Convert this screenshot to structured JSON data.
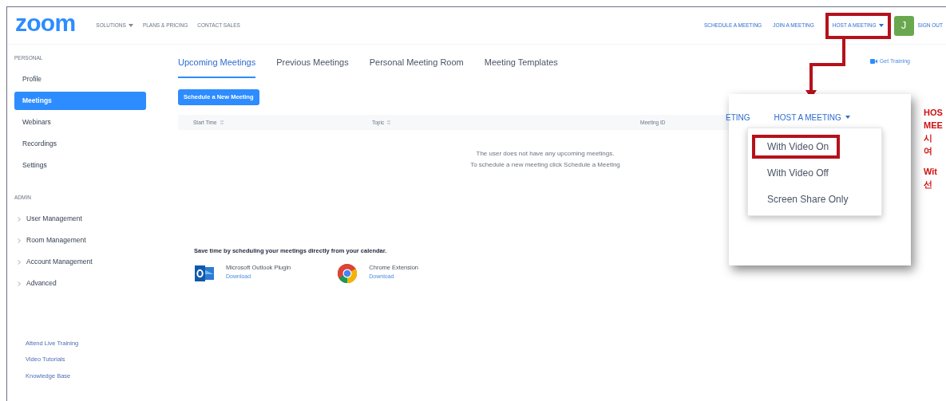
{
  "header": {
    "logo": "zoom",
    "nav": [
      {
        "label": "SOLUTIONS",
        "dropdown": true
      },
      {
        "label": "PLANS & PRICING",
        "dropdown": false
      },
      {
        "label": "CONTACT SALES",
        "dropdown": false
      }
    ],
    "actions": [
      {
        "label": "SCHEDULE A MEETING",
        "dropdown": false,
        "highlighted": false
      },
      {
        "label": "JOIN A MEETING",
        "dropdown": false,
        "highlighted": false
      },
      {
        "label": "HOST A MEETING",
        "dropdown": true,
        "highlighted": true
      }
    ],
    "avatar": "J",
    "sign_out": "SIGN OUT"
  },
  "sidebar": {
    "sections": [
      {
        "heading": "PERSONAL",
        "items": [
          {
            "label": "Profile",
            "selected": false,
            "expandable": false
          },
          {
            "label": "Meetings",
            "selected": true,
            "expandable": false
          },
          {
            "label": "Webinars",
            "selected": false,
            "expandable": false
          },
          {
            "label": "Recordings",
            "selected": false,
            "expandable": false
          },
          {
            "label": "Settings",
            "selected": false,
            "expandable": false
          }
        ]
      },
      {
        "heading": "ADMIN",
        "items": [
          {
            "label": "User Management",
            "selected": false,
            "expandable": true
          },
          {
            "label": "Room Management",
            "selected": false,
            "expandable": true
          },
          {
            "label": "Account Management",
            "selected": false,
            "expandable": true
          },
          {
            "label": "Advanced",
            "selected": false,
            "expandable": true
          }
        ]
      }
    ],
    "links": [
      "Attend Live Training",
      "Video Tutorials",
      "Knowledge Base"
    ]
  },
  "tabs": [
    {
      "label": "Upcoming Meetings",
      "selected": true
    },
    {
      "label": "Previous Meetings",
      "selected": false
    },
    {
      "label": "Personal Meeting Room",
      "selected": false
    },
    {
      "label": "Meeting Templates",
      "selected": false
    }
  ],
  "get_training": "Get Training",
  "schedule_button": "Schedule a New Meeting",
  "table": {
    "columns": [
      {
        "label": "Start Time",
        "sortable": true
      },
      {
        "label": "Topic",
        "sortable": true
      },
      {
        "label": "Meeting ID",
        "sortable": false
      }
    ],
    "empty_message": [
      "The user does not have any upcoming meetings.",
      "To schedule a new meeting click Schedule a Meeting"
    ]
  },
  "calendar": {
    "heading": "Save time by scheduling your meetings directly from your calendar.",
    "integrations": [
      {
        "kind": "outlook",
        "name": "Microsoft Outlook Plugin",
        "link": "Download"
      },
      {
        "kind": "chrome",
        "name": "Chrome Extension",
        "link": "Download"
      }
    ]
  },
  "callout": {
    "cut_label": "ETING",
    "menu_label": "HOST A MEETING",
    "menu_items": [
      {
        "label": "With Video On",
        "highlighted": true
      },
      {
        "label": "With Video Off",
        "highlighted": false
      },
      {
        "label": "Screen Share Only",
        "highlighted": false
      }
    ]
  },
  "annotation": {
    "paragraphs": [
      [
        "HOS",
        "MEE",
        "시",
        "여"
      ],
      [
        "Wit",
        "선"
      ]
    ]
  }
}
